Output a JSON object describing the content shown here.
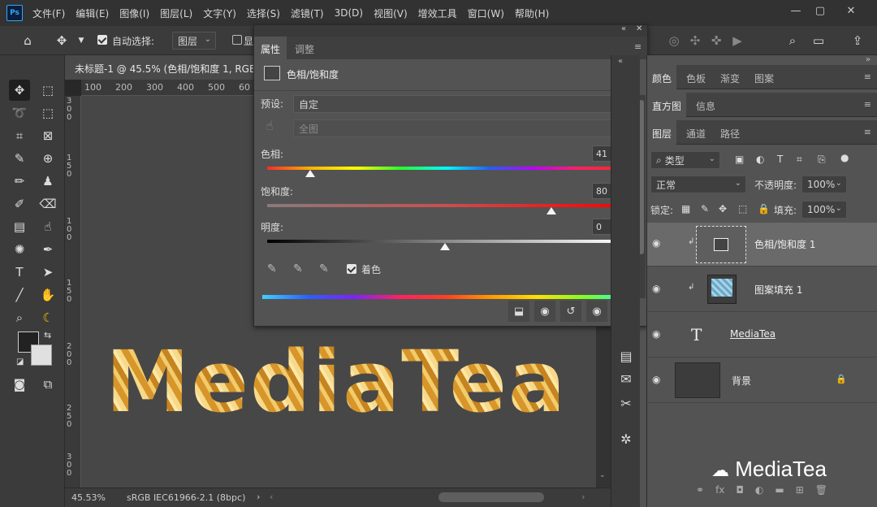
{
  "menubar": {
    "logo": "Ps",
    "items": [
      "文件(F)",
      "编辑(E)",
      "图像(I)",
      "图层(L)",
      "文字(Y)",
      "选择(S)",
      "滤镜(T)",
      "3D(D)",
      "视图(V)",
      "增效工具",
      "窗口(W)",
      "帮助(H)"
    ]
  },
  "options": {
    "auto_select_label": "自动选择:",
    "auto_select_value": "图层",
    "show_label": "显"
  },
  "document": {
    "tab_title": "未标题-1 @ 45.5% (色相/饱和度 1, RGB",
    "zoom": "45.53%",
    "color_profile": "sRGB IEC61966-2.1 (8bpc)",
    "ruler_top": [
      "100",
      "200",
      "300",
      "400",
      "500",
      "60"
    ],
    "ruler_left": [
      "3",
      "0",
      "0",
      "1",
      "5",
      "0",
      "1",
      "0",
      "0",
      "1",
      "5",
      "0",
      "2",
      "0",
      "0",
      "2",
      "5",
      "0",
      "3",
      "0",
      "0"
    ],
    "artwork_text": "MediaTea"
  },
  "properties": {
    "tab_properties": "属性",
    "tab_adjustments": "调整",
    "title": "色相/饱和度",
    "preset_label": "预设:",
    "preset_value": "自定",
    "channel_value": "全图",
    "hue_label": "色相:",
    "hue_value": "41",
    "hue_level": 0.12,
    "saturation_label": "饱和度:",
    "saturation_value": "80",
    "saturation_level": 0.8,
    "lightness_label": "明度:",
    "lightness_value": "0",
    "lightness_level": 0.5,
    "colorize_label": "着色"
  },
  "right_panel": {
    "tabs_row1": [
      "颜色",
      "色板",
      "渐变",
      "图案"
    ],
    "tabs_row2": [
      "直方图",
      "信息"
    ],
    "tabs_row3": [
      "图层",
      "通道",
      "路径"
    ],
    "filter_kind": "类型",
    "blend_mode": "正常",
    "opacity_label": "不透明度:",
    "opacity_value": "100%",
    "lock_label": "锁定:",
    "fill_label": "填充:",
    "fill_value": "100%",
    "layers": [
      {
        "name": "色相/饱和度 1",
        "type": "adjustment"
      },
      {
        "name": "图案填充 1",
        "type": "pattern"
      },
      {
        "name": "MediaTea",
        "type": "text"
      },
      {
        "name": "背景",
        "type": "background"
      }
    ]
  },
  "watermark": "MediaTea",
  "colors": {
    "accent": "#31a8ff",
    "foreground": "#222222",
    "background": "#e0e0e0"
  }
}
